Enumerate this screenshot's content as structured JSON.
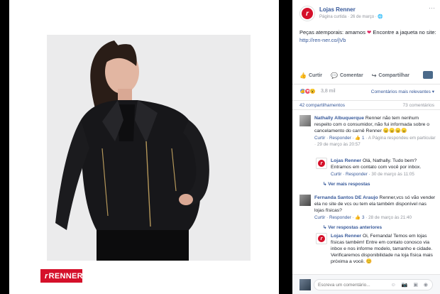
{
  "photo": {
    "brand_logo": "RENNER",
    "brand_mark": "r"
  },
  "page": {
    "name": "Lojas Renner",
    "meta": "Página curtida · 26 de março · 🌐",
    "more": "···"
  },
  "post": {
    "text_before_heart": "Peças atemporais: amamos ",
    "heart": "❤",
    "text_after_heart": " Encontre a jaqueta no site: ",
    "link": "http://ren-ner.co/jVb"
  },
  "actions": {
    "like": "Curtir",
    "comment": "Comentar",
    "share": "Compartilhar"
  },
  "reactions": {
    "count": "3,8 mil",
    "sort": "Comentários mais relevantes ▾"
  },
  "counts": {
    "shares": "42 compartilhamentos",
    "comments": "73 comentários"
  },
  "comments": [
    {
      "author": "Nathally Albuquerque",
      "text": " Renner não tem nenhum respeito com o consumidor, não fui informada sobre o cancelamento do carnê Renner",
      "emojis": "😠😠😠😠",
      "meta_actions": "Curtir · Responder · ",
      "meta_likes": "👍 1",
      "meta_rest": " · A Página respondeu em particular · 29 de março às 20:57"
    },
    {
      "author": "Lojas Renner",
      "text": " Olá, Nathally. Tudo bem? Entramos em contato com você por inbox.",
      "meta_actions": "Curtir · Responder · ",
      "meta_rest": "30 de março às 11:05"
    },
    {
      "author": "Fernanda Santos DE Araujo",
      "text": " Renner,vcs só vão vender ela no site de vcs ou tem ela também disponível nas lojas físicas?",
      "meta_actions": "Curtir · Responder · ",
      "meta_likes": "👍 3",
      "meta_rest": " · 28 de março às 21:40"
    },
    {
      "author": "Lojas Renner",
      "text": " Oi, Fernanda! Temos em lojas físicas também! Entre em contato conosco via inbox e nos informe modelo, tamanho e cidade. Verificaremos disponibilidade na loja física mais próxima a você.",
      "emojis": "😊"
    }
  ],
  "view_more_replies": "↳ Ver mais respostas",
  "view_previous_replies": "↳ Ver respostas anteriores",
  "comment_input": {
    "placeholder": "Escreva um comentário...",
    "icons": "☺ 📷 ▣ ◉"
  },
  "colors": {
    "brand_red": "#d5102a",
    "link_blue": "#365899",
    "love": "#e0245e"
  }
}
